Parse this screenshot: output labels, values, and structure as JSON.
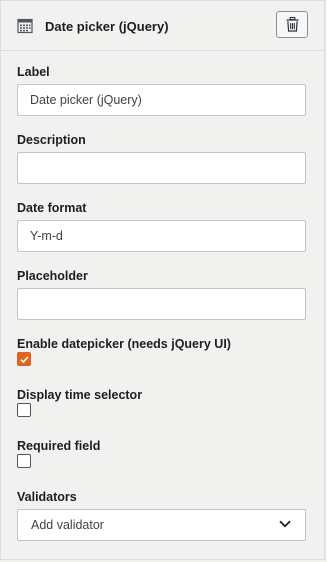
{
  "header": {
    "title": "Date picker (jQuery)",
    "icon": "calendar-icon",
    "delete_icon": "trash-icon"
  },
  "fields": {
    "label": {
      "label": "Label",
      "value": "Date picker (jQuery)"
    },
    "description": {
      "label": "Description",
      "value": ""
    },
    "date_format": {
      "label": "Date format",
      "value": "Y-m-d"
    },
    "placeholder": {
      "label": "Placeholder",
      "value": ""
    }
  },
  "checkboxes": {
    "enable_datepicker": {
      "label": "Enable datepicker (needs jQuery UI)",
      "checked": true
    },
    "display_time": {
      "label": "Display time selector",
      "checked": false
    },
    "required": {
      "label": "Required field",
      "checked": false
    }
  },
  "validators": {
    "label": "Validators",
    "selected": "Add validator"
  },
  "colors": {
    "accent": "#e0631e",
    "background": "#f1f2f0",
    "border": "#c3c4c7"
  }
}
